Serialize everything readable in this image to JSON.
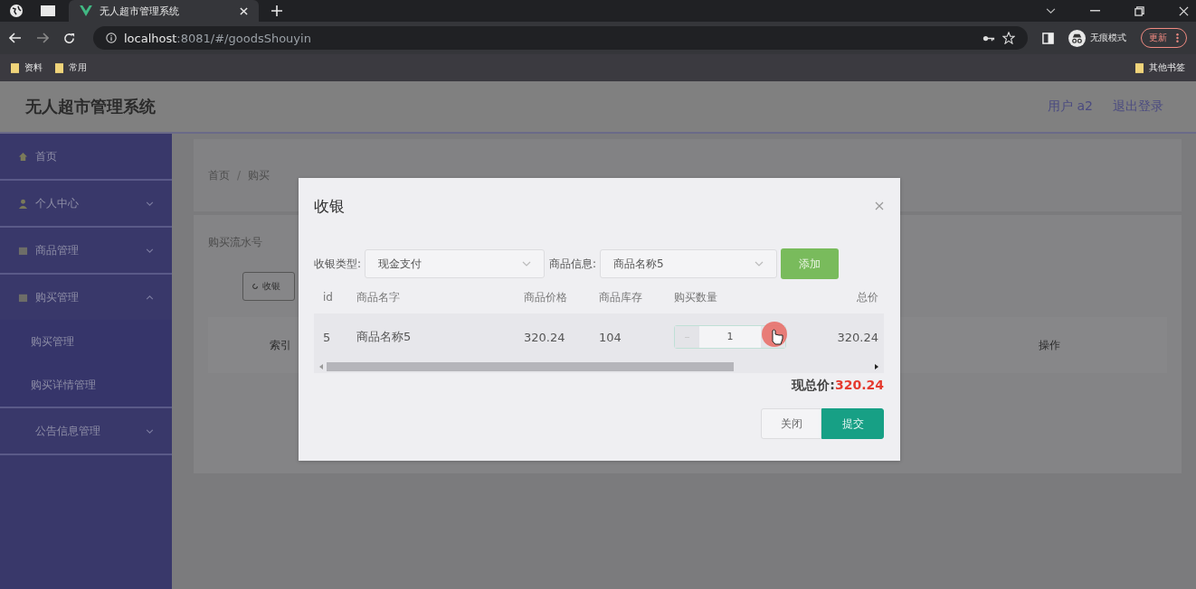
{
  "browser": {
    "tabs": [
      {
        "title": "无人超市管理系统",
        "selected": true
      }
    ],
    "url": {
      "host": "localhost",
      "rest": ":8081/#/goodsShouyin"
    },
    "incognito_label": "无痕模式",
    "update_button": "更新",
    "bookmarks": [
      "资料",
      "常用"
    ],
    "other_bookmarks": "其他书签"
  },
  "header": {
    "title": "无人超市管理系统",
    "user": "用户 a2",
    "logout": "退出登录"
  },
  "sidebar": {
    "items": [
      {
        "label": "首页"
      },
      {
        "label": "个人中心",
        "expanded": false
      },
      {
        "label": "商品管理",
        "expanded": false
      },
      {
        "label": "购买管理",
        "expanded": true,
        "children": [
          {
            "label": "购买管理"
          },
          {
            "label": "购买详情管理"
          }
        ]
      },
      {
        "label": "公告信息管理",
        "expanded": false
      }
    ]
  },
  "page": {
    "breadcrumb": [
      "首页",
      "购买"
    ],
    "breadcrumb_separator": "/",
    "search_label": "购买流水号",
    "cashier_button": "收银",
    "table_columns": [
      "索引",
      "操作"
    ]
  },
  "dialog": {
    "title": "收银",
    "fields": [
      {
        "label": "收银类型:",
        "value": "现金支付"
      },
      {
        "label": "商品信息:",
        "value": "商品名称5"
      }
    ],
    "add_button": "添加",
    "columns": [
      "id",
      "商品名字",
      "商品价格",
      "商品库存",
      "购买数量",
      "总价"
    ],
    "rows": [
      {
        "id": "5",
        "name": "商品名称5",
        "price": "320.24",
        "stock": "104",
        "quantity": "1",
        "total": "320.24"
      }
    ],
    "total_label": "现总价:",
    "total_value": "320.24",
    "buttons": [
      {
        "label": "关闭",
        "kind": "default"
      },
      {
        "label": "提交",
        "kind": "primary"
      }
    ]
  }
}
